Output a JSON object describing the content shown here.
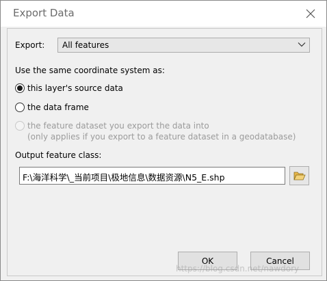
{
  "window": {
    "title": "Export Data"
  },
  "export": {
    "label": "Export:",
    "selected": "All features"
  },
  "coordinate": {
    "label": "Use the same coordinate system as:",
    "options": [
      {
        "label": "this layer's source data",
        "selected": true,
        "enabled": true
      },
      {
        "label": "the data frame",
        "selected": false,
        "enabled": true
      },
      {
        "label": "the feature dataset you export the data into",
        "selected": false,
        "enabled": false
      }
    ],
    "note": "(only applies if you export to a feature dataset in a geodatabase)"
  },
  "output": {
    "label": "Output feature class:",
    "path": "F:\\海洋科学\\_当前项目\\极地信息\\数据资源\\N5_E.shp"
  },
  "buttons": {
    "ok": "OK",
    "cancel": "Cancel"
  },
  "watermark": "https://blog.csdn.net/nawdory",
  "icons": {
    "close": "close-icon",
    "dropdown": "chevron-down-icon",
    "browse": "folder-open-icon"
  }
}
